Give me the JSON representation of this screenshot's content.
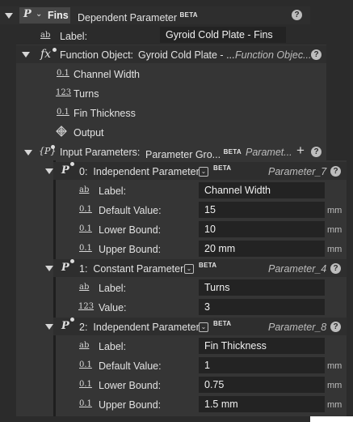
{
  "root": {
    "title": "Fins",
    "type": "Dependent Parameter",
    "beta": "BETA",
    "help": "?",
    "label_row": {
      "icon": "ab",
      "label": "Label:",
      "value": "Gyroid Cold Plate - Fins"
    }
  },
  "function_object": {
    "label": "Function Object:",
    "value": "Gyroid Cold Plate - ...",
    "type": "Function Objec...",
    "help": "?",
    "items": [
      {
        "icon": "0.1",
        "label": "Channel Width"
      },
      {
        "icon": "123",
        "label": "Turns"
      },
      {
        "icon": "0.1",
        "label": "Fin Thickness"
      }
    ],
    "output": "Output"
  },
  "input_params": {
    "label": "Input Parameters:",
    "value": "Parameter Gro...",
    "beta": "BETA",
    "type": "Paramet...",
    "plus": "+",
    "help": "?"
  },
  "params": [
    {
      "index": "0:",
      "kind": "Independent Parameter",
      "beta": "BETA",
      "name": "Parameter_7",
      "help": "?",
      "rows": [
        {
          "icon": "ab",
          "label": "Label:",
          "value": "Channel Width",
          "unit": ""
        },
        {
          "icon": "0.1",
          "label": "Default Value:",
          "value": "15",
          "unit": "mm"
        },
        {
          "icon": "0.1",
          "label": "Lower Bound:",
          "value": "10",
          "unit": "mm"
        },
        {
          "icon": "0.1",
          "label": "Upper Bound:",
          "value": "20 mm",
          "unit": "mm"
        }
      ]
    },
    {
      "index": "1:",
      "kind": "Constant Parameter",
      "beta": "BETA",
      "name": "Parameter_4",
      "help": "?",
      "rows": [
        {
          "icon": "ab",
          "label": "Label:",
          "value": "Turns",
          "unit": ""
        },
        {
          "icon": "123",
          "label": "Value:",
          "value": "3",
          "unit": ""
        }
      ]
    },
    {
      "index": "2:",
      "kind": "Independent Parameter",
      "beta": "BETA",
      "name": "Parameter_8",
      "help": "?",
      "rows": [
        {
          "icon": "ab",
          "label": "Label:",
          "value": "Fin Thickness",
          "unit": ""
        },
        {
          "icon": "0.1",
          "label": "Default Value:",
          "value": "1",
          "unit": "mm"
        },
        {
          "icon": "0.1",
          "label": "Lower Bound:",
          "value": "0.75",
          "unit": "mm"
        },
        {
          "icon": "0.1",
          "label": "Upper Bound:",
          "value": "1.5 mm",
          "unit": "mm"
        }
      ]
    }
  ]
}
